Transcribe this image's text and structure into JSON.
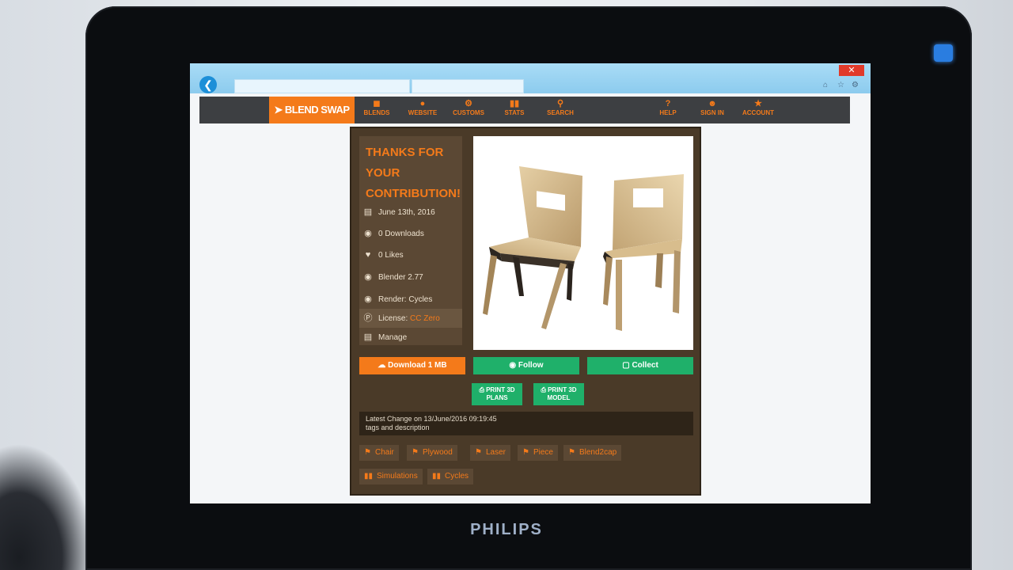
{
  "device": {
    "brand": "PHILIPS"
  },
  "browser": {
    "address": "",
    "tab": ""
  },
  "nav": {
    "logo": "BLEND SWAP",
    "items": [
      {
        "label": "BLENDS",
        "icon": "cube-icon"
      },
      {
        "label": "WEBSITE",
        "icon": "globe-icon"
      },
      {
        "label": "CUSTOMS",
        "icon": "gear-icon"
      },
      {
        "label": "STATS",
        "icon": "bars-icon"
      },
      {
        "label": "SEARCH",
        "icon": "search-icon"
      },
      {
        "label": "HELP",
        "icon": "help-icon"
      },
      {
        "label": "SIGN IN",
        "icon": "user-icon"
      },
      {
        "label": "ACCOUNT",
        "icon": "account-icon"
      }
    ]
  },
  "contribution": {
    "heading": "THANKS FOR YOUR CONTRIBUTION!",
    "date": "June 13th, 2016",
    "downloads": "0 Downloads",
    "likes": "0 Likes",
    "blender": "Blender 2.77",
    "render": "Render: Cycles",
    "license_label": "License:",
    "license_value": "CC Zero",
    "manage": "Manage"
  },
  "actions": {
    "download": "Download 1 MB",
    "follow": "Follow",
    "collect": "Collect",
    "print_plans": "PRINT 3D PLANS",
    "print_model": "PRINT 3D MODEL"
  },
  "latest_change": {
    "line1": "Latest Change on 13/June/2016 09:19:45",
    "line2": "tags and description"
  },
  "tags": [
    "Chair",
    "Plywood",
    "Laser",
    "Piece",
    "Blend2cap"
  ],
  "categories": [
    "Simulations",
    "Cycles"
  ],
  "colors": {
    "accent": "#f47a1a",
    "green": "#1fb06a",
    "panel": "#4a3a28",
    "nav": "#3d3f42"
  }
}
